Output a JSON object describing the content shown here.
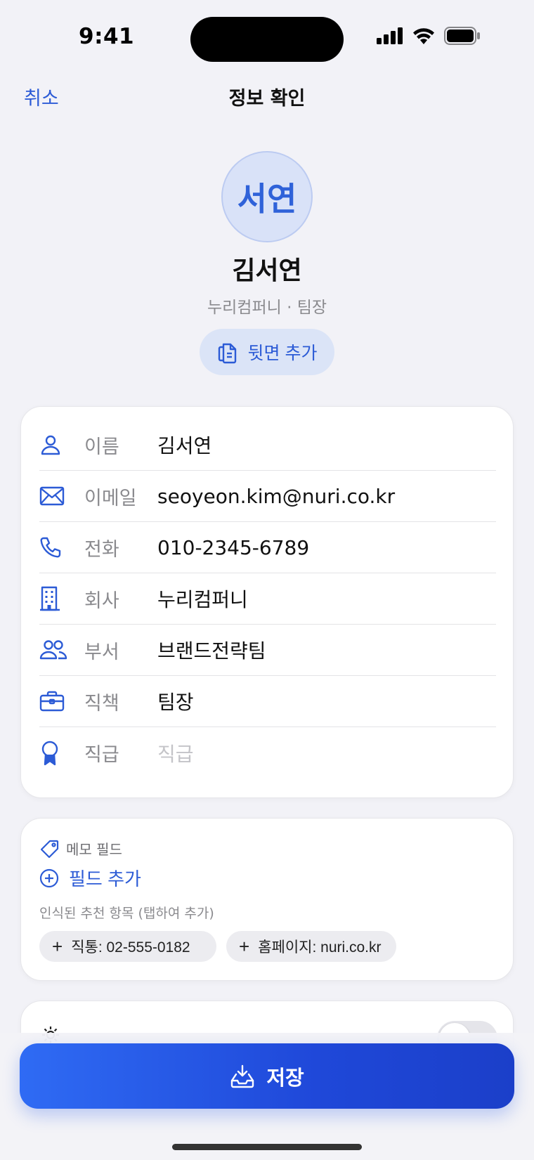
{
  "status": {
    "time": "9:41"
  },
  "nav": {
    "cancel": "취소",
    "title": "정보 확인"
  },
  "profile": {
    "avatar_text": "서연",
    "name": "김서연",
    "subtitle": "누리컴퍼니 · 팀장",
    "back_button": "뒷면 추가"
  },
  "fields": [
    {
      "icon": "person-icon",
      "label": "이름",
      "value": "김서연"
    },
    {
      "icon": "envelope-icon",
      "label": "이메일",
      "value": "seoyeon.kim@nuri.co.kr"
    },
    {
      "icon": "phone-icon",
      "label": "전화",
      "value": "010-2345-6789"
    },
    {
      "icon": "building-icon",
      "label": "회사",
      "value": "누리컴퍼니"
    },
    {
      "icon": "people-icon",
      "label": "부서",
      "value": "브랜드전략팀"
    },
    {
      "icon": "briefcase-icon",
      "label": "직책",
      "value": "팀장"
    },
    {
      "icon": "award-icon",
      "label": "직급",
      "placeholder": "직급"
    }
  ],
  "memo": {
    "title": "메모 필드",
    "add_field": "필드 추가",
    "suggest_caption": "인식된 추천 항목 (탭하여 추가)",
    "chips": [
      "직통: 02-555-0182",
      "홈페이지: nuri.co.kr"
    ]
  },
  "partial_card": {
    "label": "",
    "toggle_on": false
  },
  "save": {
    "label": "저장"
  },
  "colors": {
    "accent": "#2c5bd6",
    "background": "#f2f2f7",
    "avatar_bg": "#d9e2f8"
  }
}
